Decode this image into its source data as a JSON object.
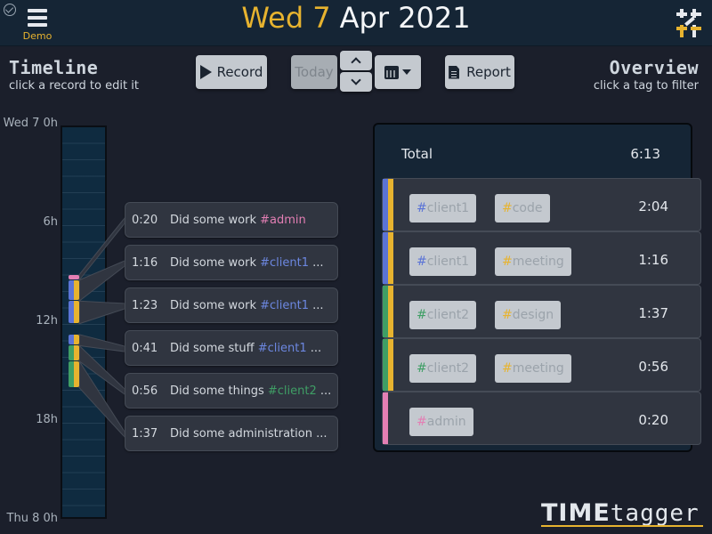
{
  "header": {
    "demo_label": "Demo",
    "date_day": "Wed 7",
    "date_rest": "Apr 2021"
  },
  "timeline": {
    "title": "Timeline",
    "subtitle": "click a record to edit it",
    "ticks": [
      "Wed 7 0h",
      "6h",
      "12h",
      "18h",
      "Thu 8 0h"
    ]
  },
  "toolbar": {
    "record_label": "Record",
    "today_label": "Today",
    "report_label": "Report"
  },
  "records": [
    {
      "duration": "0:20",
      "text": "Did some work ",
      "tag": "#admin",
      "tag_color": "#e37fb4",
      "more": "",
      "colors": [
        "#e37fb4"
      ],
      "start_h": 9.17,
      "end_h": 9.5
    },
    {
      "duration": "1:16",
      "text": "Did some work ",
      "tag": "#client1",
      "tag_color": "#6c87e0",
      "more": " ...",
      "colors": [
        "#5b74d6",
        "#e7b32f"
      ],
      "start_h": 9.5,
      "end_h": 10.77
    },
    {
      "duration": "1:23",
      "text": "Did some work ",
      "tag": "#client1",
      "tag_color": "#6c87e0",
      "more": " ...",
      "colors": [
        "#5b74d6",
        "#e7b32f"
      ],
      "start_h": 10.77,
      "end_h": 12.15
    },
    {
      "duration": "0:41",
      "text": "Did some stuff ",
      "tag": "#client1",
      "tag_color": "#6c87e0",
      "more": " ...",
      "colors": [
        "#5b74d6",
        "#e7b32f"
      ],
      "start_h": 12.8,
      "end_h": 13.48
    },
    {
      "duration": "0:56",
      "text": "Did some things ",
      "tag": "#client2",
      "tag_color": "#3f9e65",
      "more": " ...",
      "colors": [
        "#3f9e65",
        "#e7b32f"
      ],
      "start_h": 13.48,
      "end_h": 14.42
    },
    {
      "duration": "1:37",
      "text": "Did some administration ...",
      "tag": "",
      "tag_color": "#3f9e65",
      "more": "",
      "colors": [
        "#3f9e65",
        "#e7b32f"
      ],
      "start_h": 14.42,
      "end_h": 16.03
    }
  ],
  "overview": {
    "title": "Overview",
    "subtitle": "click a tag to filter",
    "total_label": "Total",
    "total_value": "6:13",
    "rows": [
      {
        "duration": "2:04",
        "colors": [
          "#5b74d6",
          "#e7b32f"
        ],
        "tags": [
          {
            "hash_color": "#5b74d6",
            "name": "client1"
          },
          {
            "hash_color": "#e7b32f",
            "name": "code"
          }
        ]
      },
      {
        "duration": "1:16",
        "colors": [
          "#5b74d6",
          "#e7b32f"
        ],
        "tags": [
          {
            "hash_color": "#5b74d6",
            "name": "client1"
          },
          {
            "hash_color": "#e7b32f",
            "name": "meeting"
          }
        ]
      },
      {
        "duration": "1:37",
        "colors": [
          "#3f9e65",
          "#e7b32f"
        ],
        "tags": [
          {
            "hash_color": "#3f9e65",
            "name": "client2"
          },
          {
            "hash_color": "#e7b32f",
            "name": "design"
          }
        ]
      },
      {
        "duration": "0:56",
        "colors": [
          "#3f9e65",
          "#e7b32f"
        ],
        "tags": [
          {
            "hash_color": "#3f9e65",
            "name": "client2"
          },
          {
            "hash_color": "#e7b32f",
            "name": "meeting"
          }
        ]
      },
      {
        "duration": "0:20",
        "colors": [
          "#e37fb4"
        ],
        "tags": [
          {
            "hash_color": "#e37fb4",
            "name": "admin"
          }
        ]
      }
    ]
  },
  "brand": {
    "time": "TIME",
    "tagger": "tagger"
  }
}
